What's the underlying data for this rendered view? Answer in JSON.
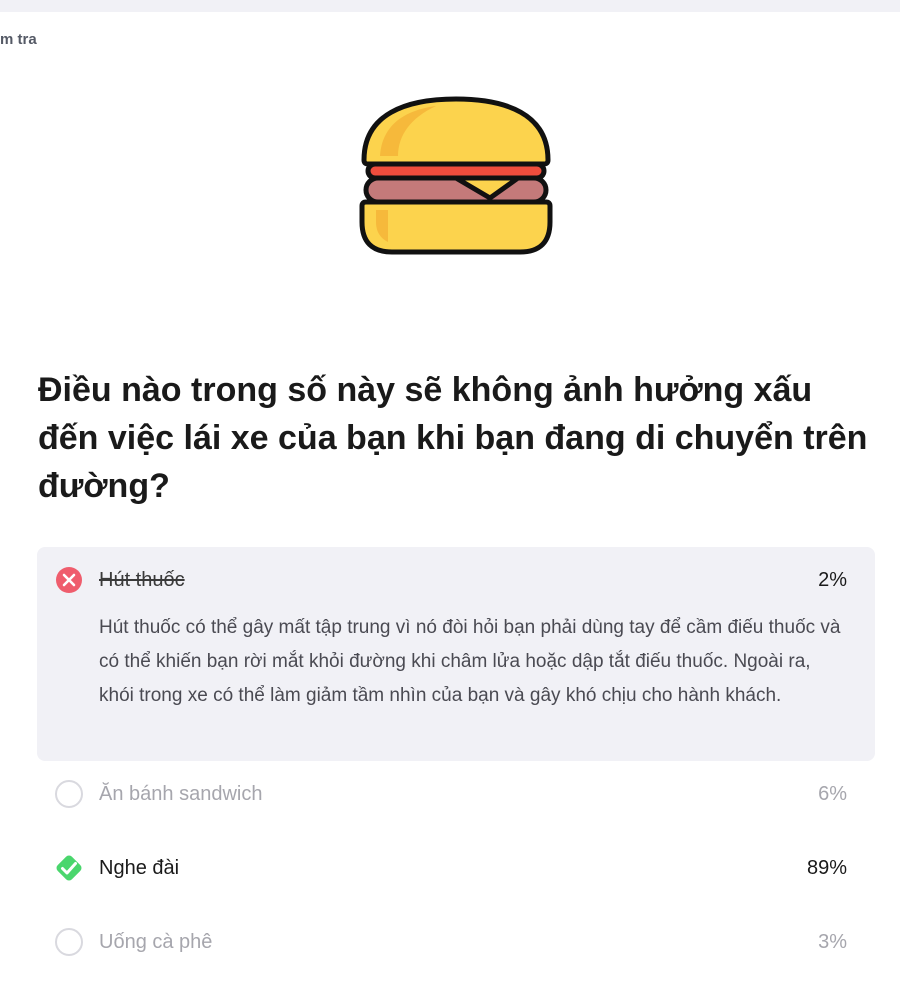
{
  "header": {
    "breadcrumb": "m tra"
  },
  "illustration": {
    "icon": "burger-icon"
  },
  "question": {
    "text": "Điều nào trong số này sẽ không ảnh hưởng xấu đến việc lái xe của bạn khi bạn đang di chuyển trên đường?"
  },
  "options": [
    {
      "label": "Hút thuốc",
      "percent": "2%",
      "state": "wrong-selected",
      "icon": "x-circle-icon",
      "explanation": "Hút thuốc có thể gây mất tập trung vì nó đòi hỏi bạn phải dùng tay để cầm điếu thuốc và có thể khiến bạn rời mắt khỏi đường khi châm lửa hoặc dập tắt điếu thuốc. Ngoài ra, khói trong xe có thể làm giảm tầm nhìn của bạn và gây khó chịu cho hành khách."
    },
    {
      "label": "Ăn bánh sandwich",
      "percent": "6%",
      "state": "unselected",
      "icon": "empty-circle-icon"
    },
    {
      "label": "Nghe đài",
      "percent": "89%",
      "state": "correct",
      "icon": "check-diamond-icon"
    },
    {
      "label": "Uống cà phê",
      "percent": "3%",
      "state": "unselected",
      "icon": "empty-circle-icon"
    }
  ],
  "colors": {
    "wrong": "#ef5d6d",
    "correct": "#4ad66d",
    "panel": "#f1f1f6",
    "muted_text": "#a6a6ad"
  }
}
